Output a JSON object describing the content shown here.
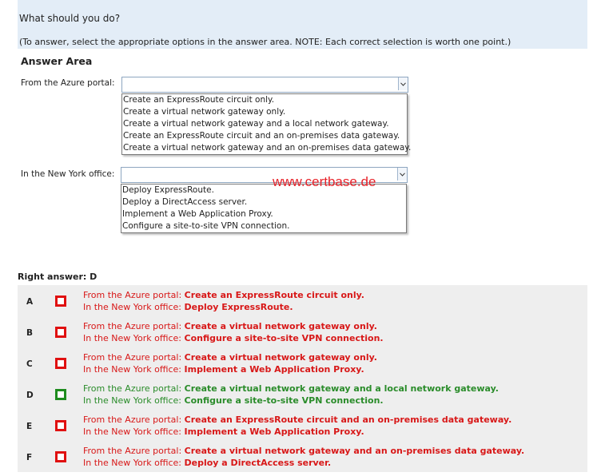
{
  "question": {
    "prompt": "What should you do?",
    "instructions": "(To answer, select the appropriate options in the answer area. NOTE: Each correct selection is worth one point.)"
  },
  "answer_area": {
    "title": "Answer Area",
    "azure_portal": {
      "label": "From the Azure portal:",
      "selected": "",
      "options": [
        "Create an ExpressRoute circuit only.",
        "Create a virtual network gateway only.",
        "Create a virtual network gateway and a local network gateway.",
        "Create an ExpressRoute circuit and an on-premises data gateway.",
        "Create a virtual network gateway and an on-premises data gateway."
      ]
    },
    "new_york_office": {
      "label": "In the New York office:",
      "selected": "",
      "options": [
        "Deploy ExpressRoute.",
        "Deploy a DirectAccess server.",
        "Implement a Web Application Proxy.",
        "Configure a site-to-site VPN connection."
      ]
    },
    "watermark": "www.certbase.de"
  },
  "right_answer": "Right answer: D",
  "results": [
    {
      "letter": "A",
      "correct": false,
      "label1": "From the Azure portal:",
      "value1": "Create an ExpressRoute circuit only.",
      "label2": "In the New York office:",
      "value2": "Deploy ExpressRoute."
    },
    {
      "letter": "B",
      "correct": false,
      "label1": "From the Azure portal:",
      "value1": "Create a virtual network gateway only.",
      "label2": "In the New York office:",
      "value2": "Configure a site-to-site VPN connection."
    },
    {
      "letter": "C",
      "correct": false,
      "label1": "From the Azure portal:",
      "value1": "Create a virtual network gateway only.",
      "label2": "In the New York office:",
      "value2": "Implement a Web Application Proxy."
    },
    {
      "letter": "D",
      "correct": true,
      "label1": "From the Azure portal:",
      "value1": "Create a virtual network gateway and a local network gateway.",
      "label2": "In the New York office:",
      "value2": "Configure a site-to-site VPN connection."
    },
    {
      "letter": "E",
      "correct": false,
      "label1": "From the Azure portal:",
      "value1": "Create an ExpressRoute circuit and an on-premises data gateway.",
      "label2": "In the New York office:",
      "value2": "Implement a Web Application Proxy."
    },
    {
      "letter": "F",
      "correct": false,
      "label1": "From the Azure portal:",
      "value1": "Create a virtual network gateway and an on-premises data gateway.",
      "label2": "In the New York office:",
      "value2": "Deploy a DirectAccess server."
    }
  ],
  "colors": {
    "correct": "#2a8c2a",
    "incorrect": "#d81818",
    "question_bg": "#e3edf7",
    "results_bg": "#eeeeee"
  }
}
